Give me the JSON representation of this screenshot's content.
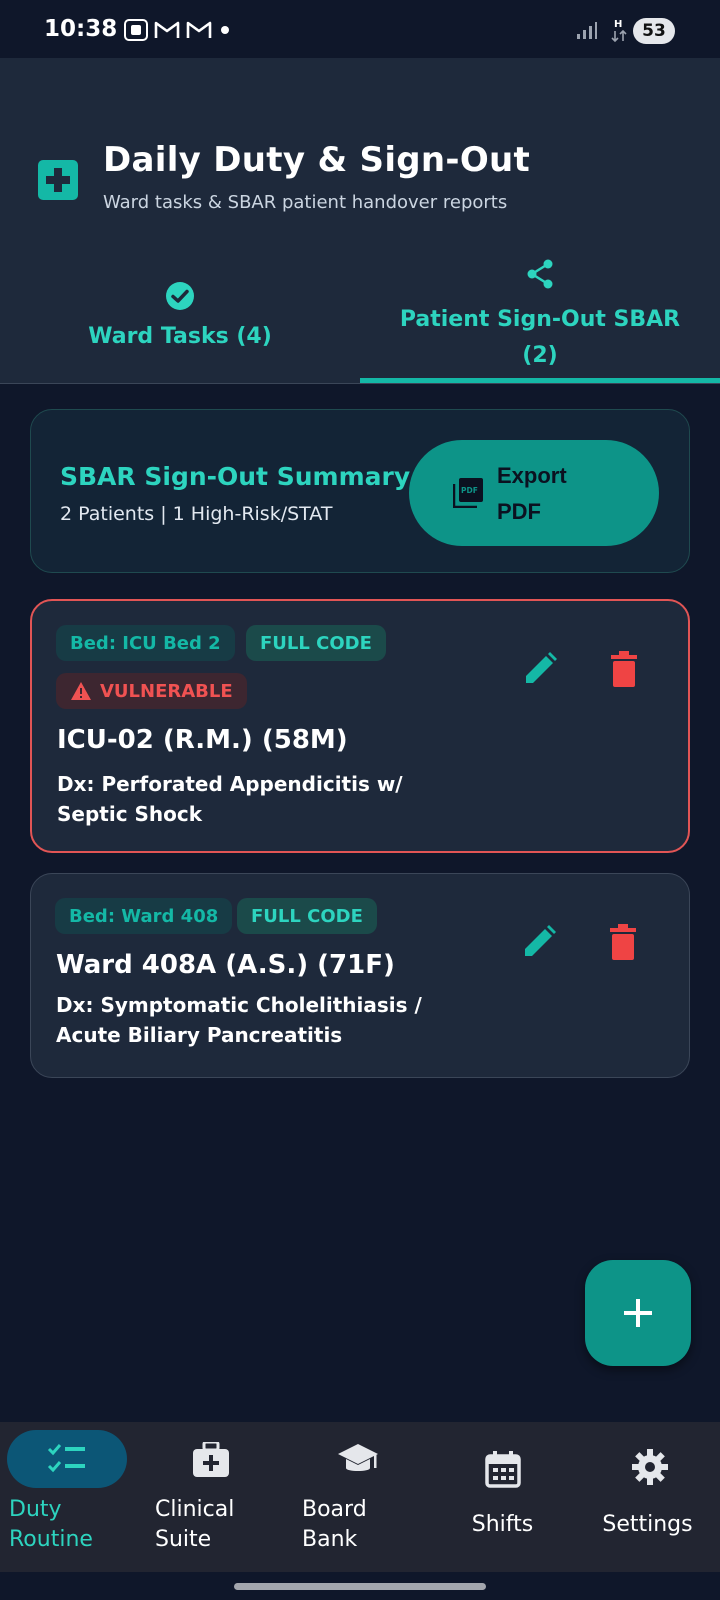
{
  "status": {
    "time": "10:38",
    "battery": "53"
  },
  "header": {
    "title": "Daily Duty & Sign-Out",
    "subtitle": "Ward tasks & SBAR patient handover reports"
  },
  "tabs": [
    {
      "label": "Ward Tasks (4)",
      "icon": "check-circle-icon",
      "active": false
    },
    {
      "label": "Patient Sign-Out SBAR (2)",
      "icon": "share-icon",
      "active": true
    }
  ],
  "summary": {
    "title": "SBAR Sign-Out Summary",
    "subtitle": "2 Patients | 1 High-Risk/STAT",
    "export_label": "Export PDF"
  },
  "patients": [
    {
      "bed": "Bed: ICU Bed 2",
      "code": "FULL CODE",
      "flag": "VULNERABLE",
      "name": "ICU-02 (R.M.) (58M)",
      "dx": "Dx: Perforated Appendicitis w/ Septic Shock"
    },
    {
      "bed": "Bed: Ward 408",
      "code": "FULL CODE",
      "name": "Ward 408A (A.S.) (71F)",
      "dx": "Dx: Symptomatic Cholelithiasis / Acute Biliary Pancreatitis"
    }
  ],
  "nav": [
    {
      "label": "Duty Routine",
      "icon": "checklist-icon",
      "active": true
    },
    {
      "label": "Clinical Suite",
      "icon": "medical-kit-icon",
      "active": false
    },
    {
      "label": "Board Bank",
      "icon": "graduation-cap-icon",
      "active": false
    },
    {
      "label": "Shifts",
      "icon": "calendar-icon",
      "active": false
    },
    {
      "label": "Settings",
      "icon": "gear-icon",
      "active": false
    }
  ],
  "colors": {
    "background": "#0f172a",
    "surface": "#1e293b",
    "accent": "#14b8a6",
    "danger": "#ef4444"
  }
}
